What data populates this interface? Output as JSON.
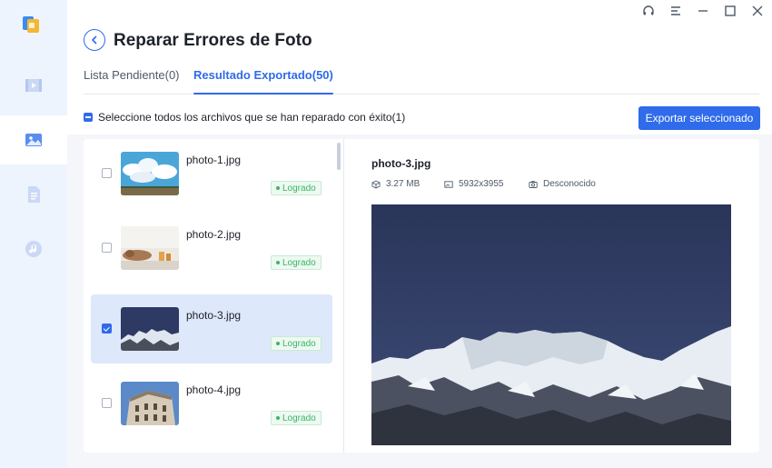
{
  "app": {
    "title": "Reparar Errores de Foto"
  },
  "window_controls": [
    "headset-icon",
    "menu-icon",
    "minimize-icon",
    "maximize-icon",
    "close-icon"
  ],
  "sidebar": {
    "items": [
      {
        "icon": "video-icon",
        "active": false
      },
      {
        "icon": "photo-icon",
        "active": true
      },
      {
        "icon": "document-icon",
        "active": false
      },
      {
        "icon": "audio-icon",
        "active": false
      }
    ]
  },
  "tabs": [
    {
      "label": "Lista Pendiente(0)",
      "active": false
    },
    {
      "label": "Resultado Exportado(50)",
      "active": true
    }
  ],
  "toolbar": {
    "select_all_label": "Seleccione todos los archivos que se han reparado con éxito(1)",
    "export_label": "Exportar seleccionado"
  },
  "files": [
    {
      "name": "photo-1.jpg",
      "status": "Logrado",
      "checked": false
    },
    {
      "name": "photo-2.jpg",
      "status": "Logrado",
      "checked": false
    },
    {
      "name": "photo-3.jpg",
      "status": "Logrado",
      "checked": true
    },
    {
      "name": "photo-4.jpg",
      "status": "Logrado",
      "checked": false
    }
  ],
  "preview": {
    "filename": "photo-3.jpg",
    "size": "3.27 MB",
    "resolution": "5932x3955",
    "device": "Desconocido"
  },
  "colors": {
    "accent": "#2f6bea",
    "success": "#3bb56a",
    "sidebar_bg": "#eef4fd",
    "selected_row": "#dde8fb"
  }
}
